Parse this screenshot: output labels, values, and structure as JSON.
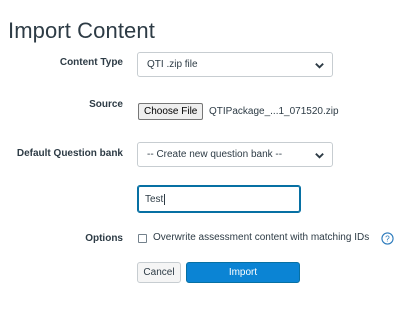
{
  "page": {
    "title": "Import Content"
  },
  "form": {
    "content_type": {
      "label": "Content Type",
      "value": "QTI .zip file"
    },
    "source": {
      "label": "Source",
      "button_label": "Choose File",
      "file_name": "QTIPackage_...1_071520.zip"
    },
    "question_bank": {
      "label": "Default Question bank",
      "value": "-- Create new question bank --"
    },
    "new_bank_name": {
      "value": "Test"
    },
    "options": {
      "label": "Options",
      "overwrite_label": "Overwrite assessment content with matching IDs",
      "overwrite_checked": false
    },
    "actions": {
      "cancel_label": "Cancel",
      "import_label": "Import"
    }
  },
  "icons": {
    "dropdown": "chevron-down-icon",
    "help": "help-circle-icon"
  },
  "colors": {
    "primary": "#0b84d4",
    "focus_border": "#0770a3",
    "help_icon": "#2b7abc"
  }
}
